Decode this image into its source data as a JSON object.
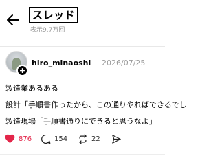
{
  "header": {
    "title": "スレッド",
    "views": "表示9.7万回"
  },
  "post": {
    "username": "hiro_minaoshi",
    "date": "2026/07/25",
    "lines": [
      "製造業あるある",
      "設計「手順書作ったから、この通りやればできるでし",
      "製造現場「手順書通りにできると思うなよ」"
    ],
    "actions": {
      "likes": "876",
      "comments": "154",
      "reposts": "22"
    },
    "like_color": "#e3264a"
  },
  "icons": [
    "back-arrow-icon",
    "follow-plus-icon",
    "heart-icon",
    "comment-icon",
    "repost-icon",
    "share-icon"
  ]
}
